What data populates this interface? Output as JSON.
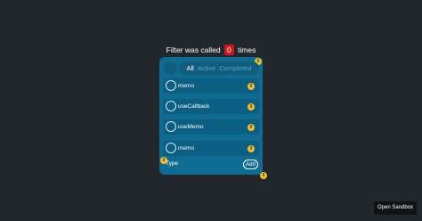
{
  "heading": {
    "prefix": "Filter was called",
    "count": "0",
    "suffix": "times"
  },
  "filters": {
    "all": "All",
    "active": "Active",
    "completed": "Completed",
    "selected": "All"
  },
  "badges": {
    "card": "0",
    "corner_left": "0",
    "corner_bottom": "0"
  },
  "todos": [
    {
      "label": "memo",
      "badge": "0",
      "completed": false
    },
    {
      "label": "useCallback",
      "badge": "0",
      "completed": false
    },
    {
      "label": "useMemo",
      "badge": "0",
      "completed": false
    },
    {
      "label": "memo",
      "badge": "0",
      "completed": false
    }
  ],
  "input": {
    "placeholder": "Type"
  },
  "add_button": {
    "label": "Add"
  },
  "sandbox_button": {
    "label": "Open Sandbox"
  },
  "colors": {
    "background": "#22262d",
    "card": "#0e6b92",
    "badge": "#f2c02f",
    "count": "#d11818"
  }
}
